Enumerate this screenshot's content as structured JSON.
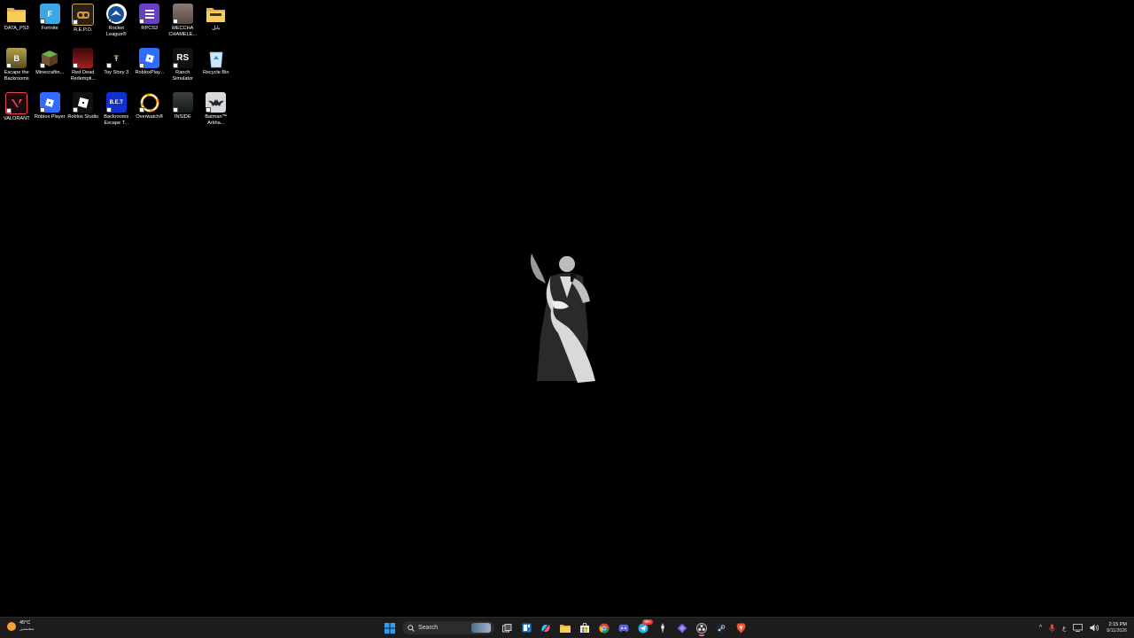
{
  "desktop": {
    "icons": [
      {
        "label": "DATA_PS3",
        "icon": "folder-icon",
        "color": "#f2c94c"
      },
      {
        "label": "Fortnite",
        "icon": "fortnite-icon",
        "color": "#3aa7e6"
      },
      {
        "label": "R.E.P.O.",
        "icon": "repo-icon",
        "color": "#2a2016"
      },
      {
        "label": "Rocket League®",
        "icon": "rocket-league-icon",
        "color": "#1a4f9c"
      },
      {
        "label": "RPCS3",
        "icon": "rpcs3-icon",
        "color": "#6a3fc8"
      },
      {
        "label": "MECCHA CHAMELE...",
        "icon": "meccha-chameleon-icon",
        "color": "#7a6a62"
      },
      {
        "label": "بابل",
        "icon": "folder-icon",
        "color": "#f2c94c"
      },
      {
        "label": "Escape the Backrooms",
        "icon": "escape-backrooms-icon",
        "color": "#8a7a2e"
      },
      {
        "label": "Minecraftin...",
        "icon": "minecraft-icon",
        "color": "#5a8f3a"
      },
      {
        "label": "Red Dead Redempti...",
        "icon": "red-dead-icon",
        "color": "#8c1d1d"
      },
      {
        "label": "Toy Story 3",
        "icon": "toy-story-icon",
        "color": "#000000"
      },
      {
        "label": "RobloxPlay...",
        "icon": "roblox-icon",
        "color": "#2f6bff"
      },
      {
        "label": "Ranch Simulator",
        "icon": "ranch-simulator-icon",
        "color": "#111111"
      },
      {
        "label": "Recycle Bin",
        "icon": "recycle-bin-icon",
        "color": "#5bb8e8"
      },
      {
        "label": "VALORANT",
        "icon": "valorant-icon",
        "color": "#f0455a"
      },
      {
        "label": "Roblox Player",
        "icon": "roblox-icon",
        "color": "#2f6bff"
      },
      {
        "label": "Roblox Studio",
        "icon": "roblox-studio-icon",
        "color": "#111111"
      },
      {
        "label": "Backrooms Escape T...",
        "icon": "bet-icon",
        "color": "#1030d0"
      },
      {
        "label": "Overwatch®",
        "icon": "overwatch-icon",
        "color": "#ffffff"
      },
      {
        "label": "INSIDE",
        "icon": "inside-icon",
        "color": "#2a2f30"
      },
      {
        "label": "Batman™ Arkha...",
        "icon": "batman-icon",
        "color": "#c8ccd0"
      }
    ]
  },
  "taskbar": {
    "weather": {
      "temp": "45°C",
      "desc": "مشمس",
      "icon": "sun-icon",
      "color": "#f7a035"
    },
    "search": {
      "placeholder": "Search"
    },
    "apps": [
      {
        "name": "start-button",
        "icon": "windows-icon"
      },
      {
        "name": "task-view",
        "icon": "task-view-icon"
      },
      {
        "name": "widgets",
        "icon": "widgets-icon"
      },
      {
        "name": "copilot",
        "icon": "copilot-icon"
      },
      {
        "name": "file-explorer",
        "icon": "folder-icon"
      },
      {
        "name": "store",
        "icon": "store-icon"
      },
      {
        "name": "chrome",
        "icon": "chrome-icon"
      },
      {
        "name": "discord",
        "icon": "discord-icon"
      },
      {
        "name": "telegram",
        "icon": "telegram-icon",
        "badge": "99+"
      },
      {
        "name": "app",
        "icon": "app-icon"
      },
      {
        "name": "vpn",
        "icon": "vpn-icon"
      },
      {
        "name": "obs",
        "icon": "obs-icon"
      },
      {
        "name": "steam",
        "icon": "steam-icon"
      },
      {
        "name": "brave",
        "icon": "brave-icon"
      }
    ],
    "tray": {
      "chevron": "^",
      "lang": "ع",
      "time": "2:15 PM",
      "date": "8/11/2026"
    }
  }
}
